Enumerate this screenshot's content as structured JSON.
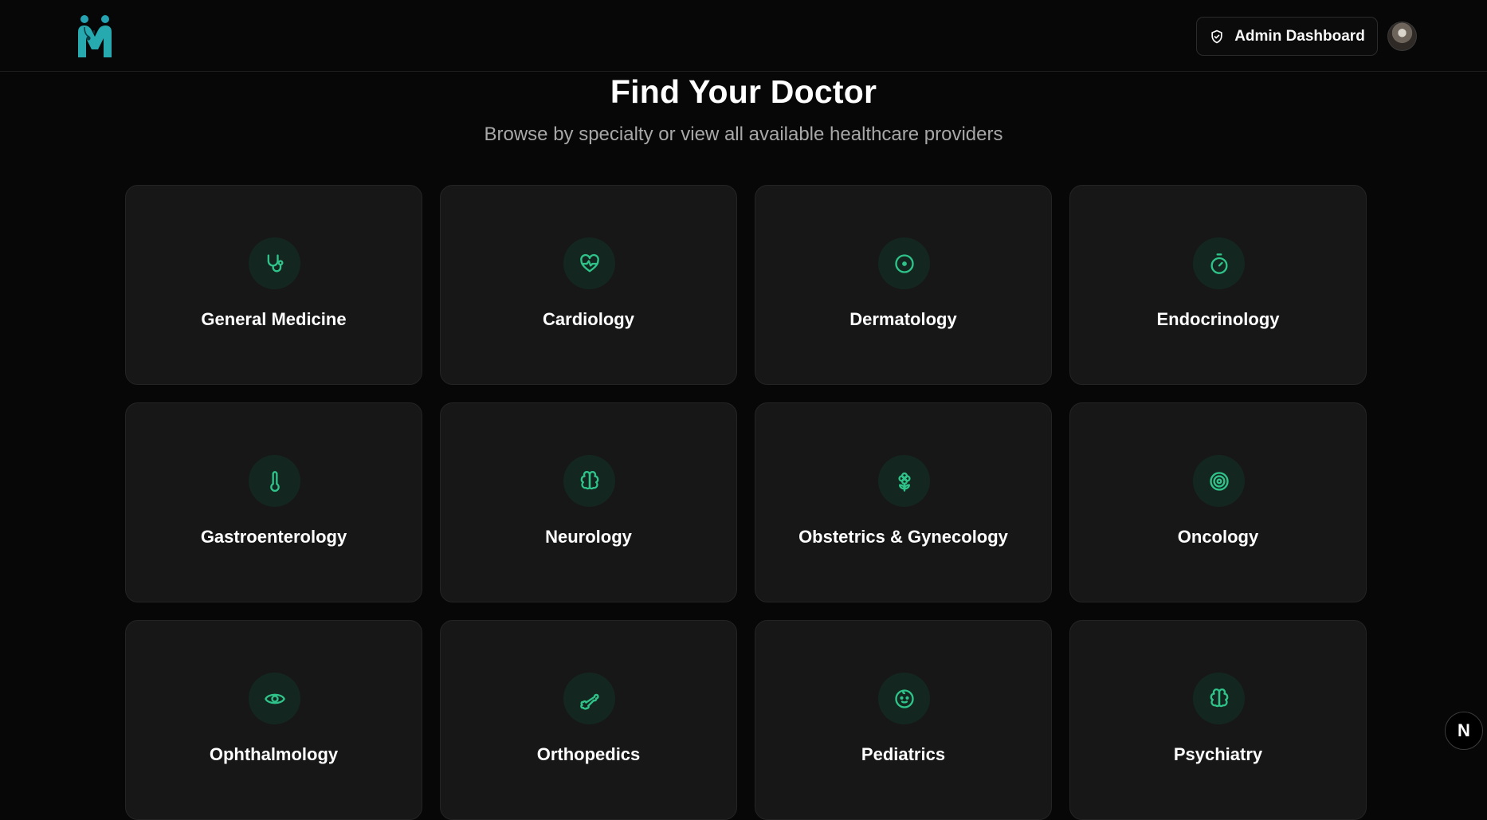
{
  "header": {
    "logo_icon": "medical-m-logo",
    "admin_button_label": "Admin Dashboard",
    "admin_button_icon": "shield-check-icon",
    "avatar_icon": "user-avatar"
  },
  "hero": {
    "title": "Find Your Doctor",
    "subtitle": "Browse by specialty or view all available healthcare providers"
  },
  "accent_color": "#2fc38a",
  "specialties": [
    {
      "label": "General Medicine",
      "icon": "stethoscope-icon"
    },
    {
      "label": "Cardiology",
      "icon": "heart-pulse-icon"
    },
    {
      "label": "Dermatology",
      "icon": "circle-dot-icon"
    },
    {
      "label": "Endocrinology",
      "icon": "timer-icon"
    },
    {
      "label": "Gastroenterology",
      "icon": "thermometer-icon"
    },
    {
      "label": "Neurology",
      "icon": "brain-icon"
    },
    {
      "label": "Obstetrics & Gynecology",
      "icon": "flower-icon"
    },
    {
      "label": "Oncology",
      "icon": "target-icon"
    },
    {
      "label": "Ophthalmology",
      "icon": "eye-icon"
    },
    {
      "label": "Orthopedics",
      "icon": "bone-icon"
    },
    {
      "label": "Pediatrics",
      "icon": "baby-icon"
    },
    {
      "label": "Psychiatry",
      "icon": "brain-icon"
    }
  ],
  "dev_badge": "N"
}
